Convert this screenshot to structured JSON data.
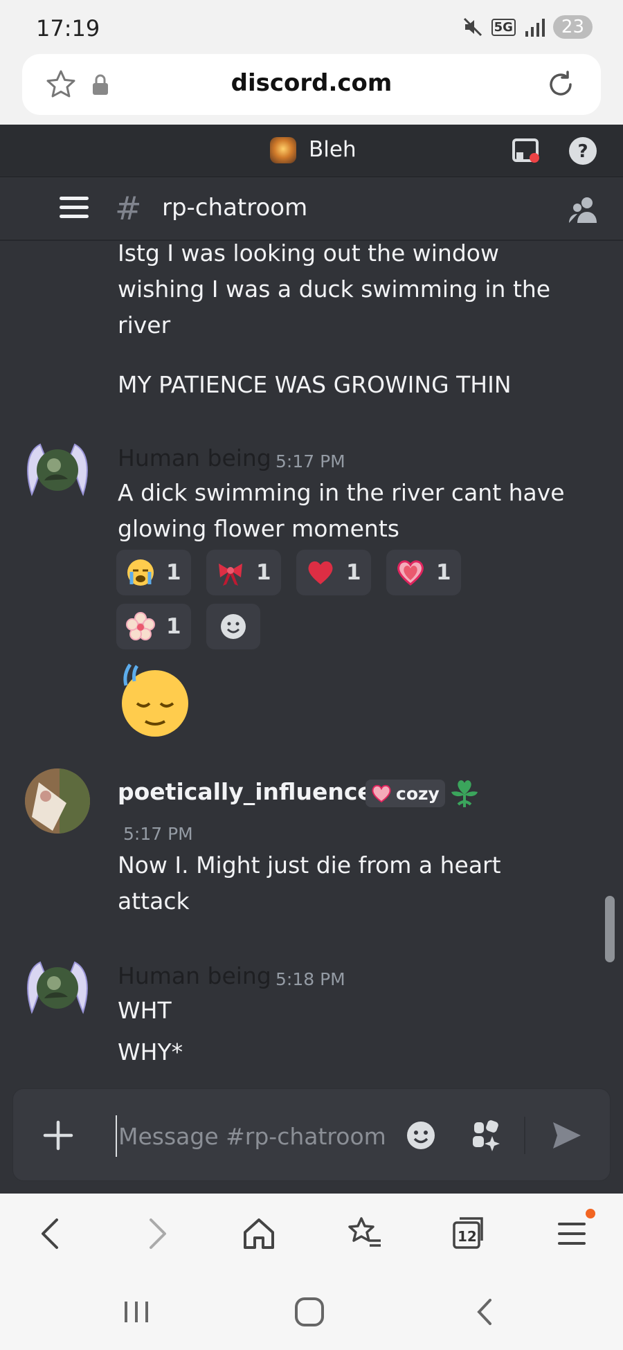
{
  "status_bar": {
    "time": "17:19",
    "network": "5G",
    "battery": "23"
  },
  "browser": {
    "url": "discord.com",
    "tabs_count": "12"
  },
  "server": {
    "name": "Bleh"
  },
  "channel": {
    "name": "rp-chatroom"
  },
  "messages": {
    "m0": {
      "lines": [
        "Istg I was looking out the window",
        "wishing I was a duck swimming in the",
        "river"
      ],
      "line4": "MY PATIENCE WAS GROWING THIN"
    },
    "m1": {
      "author": "Human being",
      "time": "5:17 PM",
      "line1": "A dick swimming in the river cant have",
      "line2": "glowing flower moments",
      "reactions": [
        {
          "emoji": "crying-face",
          "count": "1"
        },
        {
          "emoji": "ribbon",
          "count": "1"
        },
        {
          "emoji": "red-heart",
          "count": "1"
        },
        {
          "emoji": "pink-heart",
          "count": "1"
        },
        {
          "emoji": "cherry-blossom",
          "count": "1"
        }
      ]
    },
    "m2": {
      "author": "poetically_influenced",
      "tag": "cozy",
      "time": "5:17 PM",
      "line1": "Now I. Might just die from a heart",
      "line2": "attack"
    },
    "m3": {
      "author": "Human being",
      "time": "5:18 PM",
      "line1": "WHT",
      "line2": "WHY*"
    }
  },
  "composer": {
    "placeholder": "Message #rp-chatroom"
  },
  "colors": {
    "discord_bg": "#313338",
    "topbar_bg": "#2b2d31",
    "reaction_bg": "#3b3d44",
    "accent_green": "#3ba55c"
  }
}
